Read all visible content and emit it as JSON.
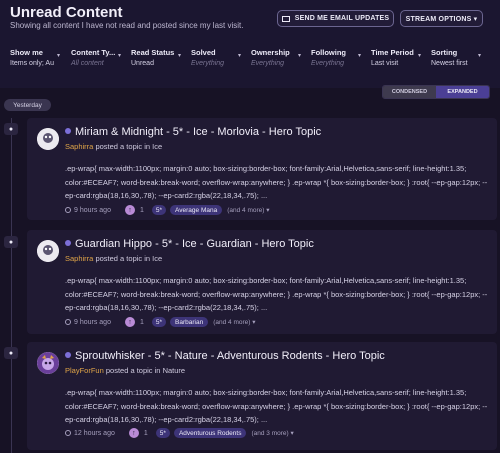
{
  "header": {
    "title": "Unread Content",
    "subtitle": "Showing all content I have not read and posted since my last visit.",
    "email_button": "SEND ME EMAIL UPDATES",
    "stream_button": "STREAM OPTIONS ▾"
  },
  "filters": [
    {
      "label": "Show me",
      "value": "Items only; Au"
    },
    {
      "label": "Content Ty...",
      "value": "All content"
    },
    {
      "label": "Read Status",
      "value": "Unread"
    },
    {
      "label": "Solved",
      "value": "Everything"
    },
    {
      "label": "Ownership",
      "value": "Everything"
    },
    {
      "label": "Following",
      "value": "Everything"
    },
    {
      "label": "Time Period",
      "value": "Last visit"
    },
    {
      "label": "Sorting",
      "value": "Newest first"
    }
  ],
  "view": {
    "condensed": "CONDENSED",
    "expanded": "EXPANDED"
  },
  "day_label": "Yesterday",
  "topics": [
    {
      "title": "Miriam & Midnight - 5* - Ice - Morlovia - Hero Topic",
      "author": "Saphirra",
      "action": "posted a topic in",
      "forum": "Ice",
      "excerpt": ".ep-wrap{ max-width:1100px; margin:0 auto; box-sizing:border-box; font-family:Arial,Helvetica,sans-serif; line-height:1.35; color:#ECEAF7; word-break:break-word; overflow-wrap:anywhere; } .ep-wrap *{ box-sizing:border-box; } :root{ --ep-gap:12px; --ep-card:rgba(18,16,30,.78); --ep-card2:rgba(22,18,34,.75); ...",
      "time": "9 hours ago",
      "replies": "1",
      "tag_count": "5*",
      "tag": "Average Mana",
      "more": "(and 4 more) ▾"
    },
    {
      "title": "Guardian Hippo - 5* - Ice - Guardian - Hero Topic",
      "author": "Saphirra",
      "action": "posted a topic in",
      "forum": "Ice",
      "excerpt": ".ep-wrap{ max-width:1100px; margin:0 auto; box-sizing:border-box; font-family:Arial,Helvetica,sans-serif; line-height:1.35; color:#ECEAF7; word-break:break-word; overflow-wrap:anywhere; } .ep-wrap *{ box-sizing:border-box; } :root{ --ep-gap:12px; --ep-card:rgba(18,16,30,.78); --ep-card2:rgba(22,18,34,.75); ...",
      "time": "9 hours ago",
      "replies": "1",
      "tag_count": "5*",
      "tag": "Barbarian",
      "more": "(and 4 more) ▾"
    },
    {
      "title": "Sproutwhisker - 5* - Nature - Adventurous Rodents - Hero Topic",
      "author": "PlayForFun",
      "action": "posted a topic in",
      "forum": "Nature",
      "excerpt": ".ep-wrap{ max-width:1100px; margin:0 auto; box-sizing:border-box; font-family:Arial,Helvetica,sans-serif; line-height:1.35; color:#ECEAF7; word-break:break-word; overflow-wrap:anywhere; } .ep-wrap *{ box-sizing:border-box; } :root{ --ep-gap:12px; --ep-card:rgba(18,16,30,.78); --ep-card2:rgba(22,18,34,.75); ...",
      "time": "12 hours ago",
      "replies": "1",
      "tag_count": "5*",
      "tag": "Adventurous Rodents",
      "more": "(and 3 more) ▾"
    }
  ]
}
